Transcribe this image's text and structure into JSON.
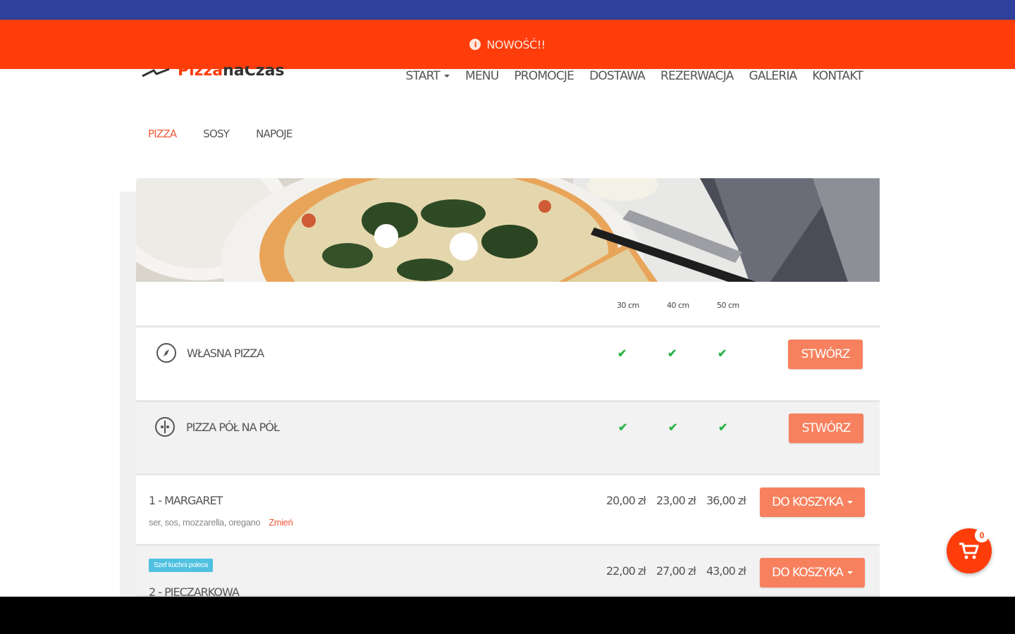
{
  "announcement": {
    "text": "NOWOŚĆ!!",
    "icon": "info-icon"
  },
  "logo": {
    "part1": "Pizza",
    "part2": "naCzas"
  },
  "nav": [
    {
      "label": "START",
      "has_dropdown": true
    },
    {
      "label": "MENU"
    },
    {
      "label": "PROMOCJE"
    },
    {
      "label": "DOSTAWA"
    },
    {
      "label": "REZERWACJA"
    },
    {
      "label": "GALERIA"
    },
    {
      "label": "KONTAKT"
    }
  ],
  "categories": [
    {
      "label": "PIZZA",
      "active": true
    },
    {
      "label": "SOSY"
    },
    {
      "label": "NAPOJE"
    }
  ],
  "sizes": [
    "30 cm",
    "40 cm",
    "50 cm"
  ],
  "custom_rows": [
    {
      "name": "WŁASNA PIZZA",
      "icon": "compass-icon",
      "button": "STWÓRZ"
    },
    {
      "name": "PIZZA PÓŁ NA PÓŁ",
      "icon": "half-pizza-icon",
      "button": "STWÓRZ"
    }
  ],
  "products": [
    {
      "title": "1 - MARGARET",
      "ingredients": "ser, sos, mozzarella, oregano",
      "change": "Zmień",
      "prices": [
        "20,00 zł",
        "23,00 zł",
        "36,00 zł"
      ],
      "button": "DO KOSZYKA"
    },
    {
      "badge": "Szef kuchni poleca",
      "title": "2 - PIECZARKOWA",
      "prices": [
        "22,00 zł",
        "27,00 zł",
        "43,00 zł"
      ],
      "button": "DO KOSZYKA"
    }
  ],
  "cart": {
    "count": "0"
  },
  "colors": {
    "accent": "#ff3d0b",
    "button": "#f7815e",
    "check": "#2db34a",
    "topbar": "#2e3f9c"
  }
}
